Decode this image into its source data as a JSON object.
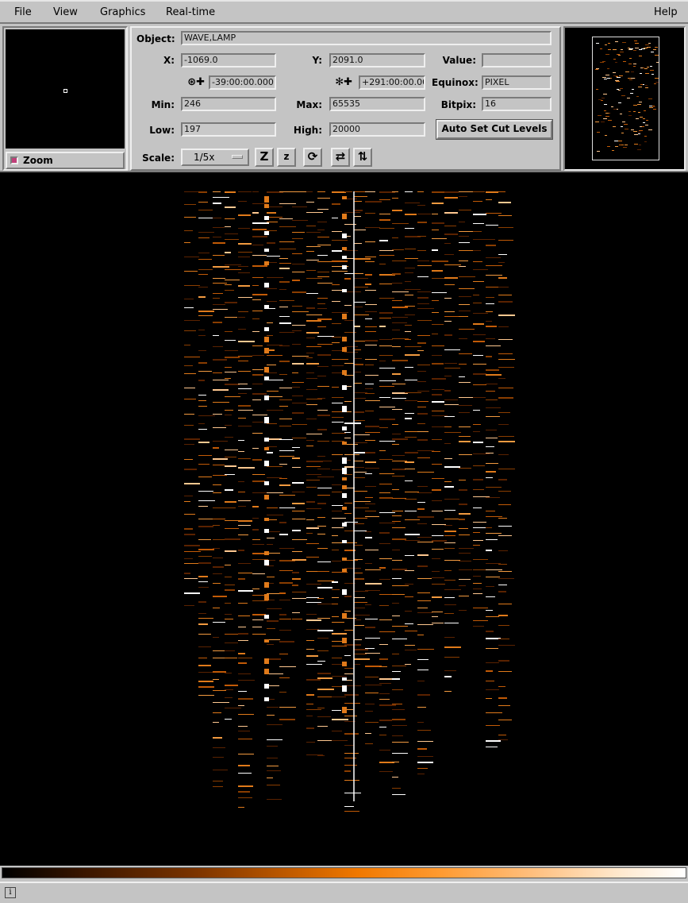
{
  "menu": {
    "file": "File",
    "view": "View",
    "graphics": "Graphics",
    "realtime": "Real-time",
    "help": "Help"
  },
  "zoom": {
    "label": "Zoom"
  },
  "info": {
    "object_label": "Object:",
    "object_value": "WAVE,LAMP",
    "x_label": "X:",
    "x_value": "-1069.0",
    "y_label": "Y:",
    "y_value": "2091.0",
    "value_label": "Value:",
    "value_value": "",
    "ra_value": "-39:00:00.000",
    "dec_value": "+291:00:00.00",
    "equinox_label": "Equinox:",
    "equinox_value": "PIXEL",
    "min_label": "Min:",
    "min_value": "246",
    "max_label": "Max:",
    "max_value": "65535",
    "bitpix_label": "Bitpix:",
    "bitpix_value": "16",
    "low_label": "Low:",
    "low_value": "197",
    "high_label": "High:",
    "high_value": "20000",
    "auto_cut_label": "Auto Set Cut Levels",
    "scale_label": "Scale:",
    "scale_value": "1/5x"
  },
  "toolbar_icons": [
    "zoom-in-icon",
    "zoom-out-icon",
    "rotate-icon",
    "flip-x-icon",
    "flip-y-icon"
  ],
  "colors": {
    "panel": "#c4c4c4",
    "image_bg": "#000000",
    "line_orange": "#e07a1a",
    "line_white": "#ffffff"
  },
  "status": {
    "icon": "i"
  }
}
